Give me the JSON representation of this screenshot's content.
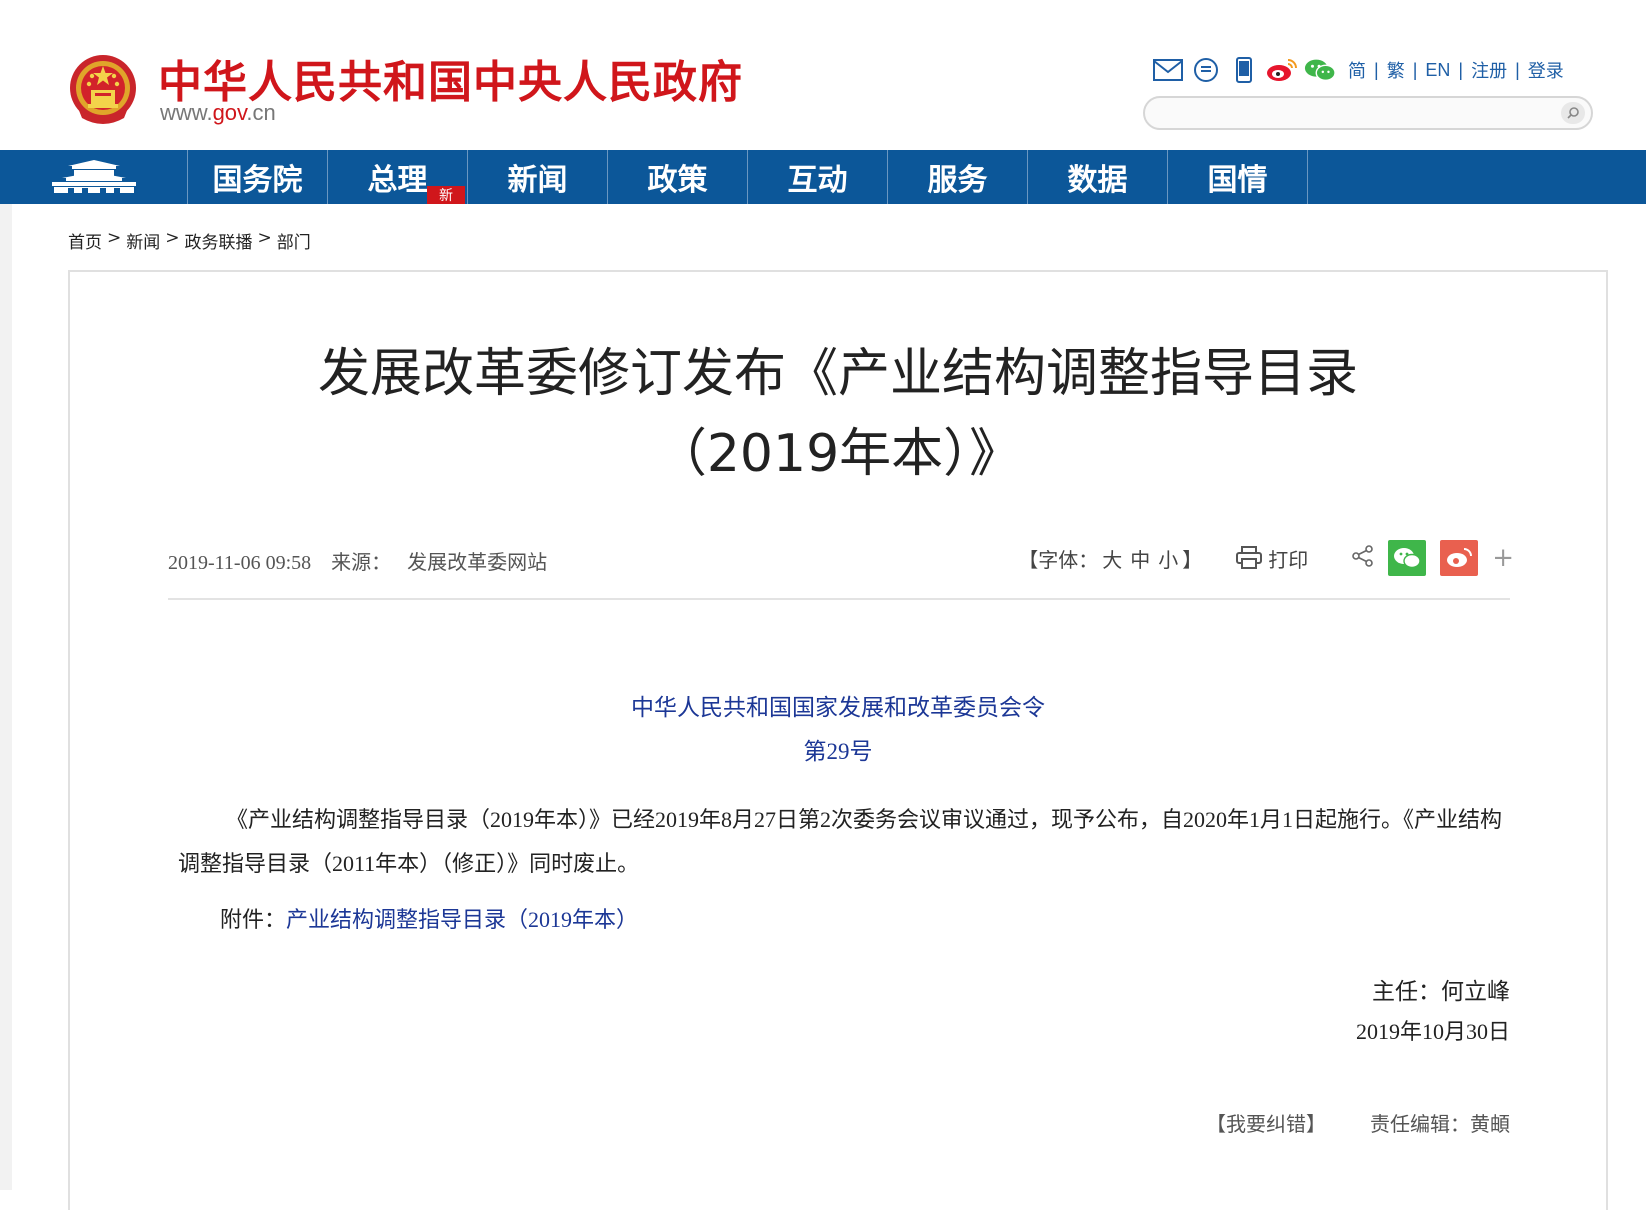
{
  "header": {
    "site_title": "中华人民共和国中央人民政府",
    "url_prefix": "www.",
    "url_accent": "gov",
    "url_suffix": ".cn",
    "tool_icons": [
      "mail-icon",
      "message-icon",
      "mobile-icon",
      "weibo-icon",
      "wechat-icon"
    ],
    "lang_links": [
      "简",
      "繁",
      "EN",
      "注册",
      "登录"
    ],
    "search": {
      "placeholder": ""
    }
  },
  "nav": {
    "items": [
      "国务院",
      "总理",
      "新闻",
      "政策",
      "互动",
      "服务",
      "数据",
      "国情"
    ],
    "badge": "新"
  },
  "breadcrumb": [
    "首页",
    "新闻",
    "政务联播",
    "部门"
  ],
  "article": {
    "title_line1": "发展改革委修订发布《产业结构调整指导目录",
    "title_line2": "（2019年本）》",
    "date": "2019-11-06 09:58",
    "source_label": "来源：",
    "source": "发展改革委网站",
    "font_label": "【字体：",
    "font_sizes": [
      "大",
      "中",
      "小"
    ],
    "font_end": "】",
    "print_label": "打印",
    "decree_title": "中华人民共和国国家发展和改革委员会令",
    "decree_no": "第29号",
    "paragraph": "《产业结构调整指导目录（2019年本）》已经2019年8月27日第2次委务会议审议通过，现予公布，自2020年1月1日起施行。《产业结构调整指导目录（2011年本）（修正）》同时废止。",
    "attachment_label": "附件：",
    "attachment_link": "产业结构调整指导目录（2019年本）",
    "signature": "主任：何立峰",
    "sign_date": "2019年10月30日",
    "correction": "【我要纠错】",
    "editor": "责任编辑：黄頔"
  },
  "colors": {
    "brand_red": "#d0161b",
    "nav_blue": "#0c5799",
    "decree_blue": "#1c3796",
    "wechat_green": "#3fb64a",
    "weibo_red": "#e9604f"
  }
}
